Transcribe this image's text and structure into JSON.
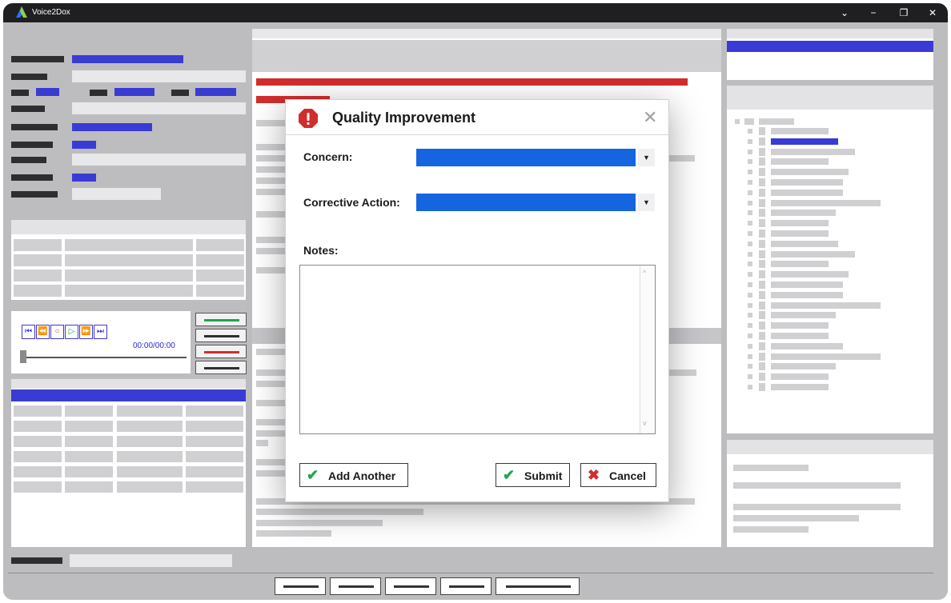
{
  "app": {
    "title": "Voice2Dox",
    "window_controls": {
      "chevron": "⌄",
      "minimize": "−",
      "restore": "❐",
      "close": "✕"
    }
  },
  "player": {
    "buttons": [
      "⏮",
      "⏪",
      "○",
      "▷",
      "⏩",
      "⏭"
    ],
    "time": "00:00/00:00",
    "position": 0
  },
  "dialog": {
    "title": "Quality Improvement",
    "icon": "warning-octagon-icon",
    "close_glyph": "✕",
    "concern_label": "Concern:",
    "corrective_label": "Corrective Action:",
    "notes_label": "Notes:",
    "notes_value": "",
    "dropdown_arrow": "▼",
    "scroll_up": "^",
    "scroll_down": "v",
    "add_another_label": "Add Another",
    "submit_label": "Submit",
    "cancel_label": "Cancel"
  },
  "colors": {
    "accent_blue": "#1665e0",
    "placeholder_blue": "#3a3ad4",
    "alert_red": "#d12d2d",
    "check_green": "#20a64a"
  }
}
